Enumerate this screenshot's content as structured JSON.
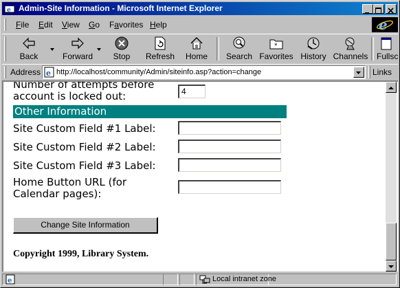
{
  "window": {
    "title": "Admin-Site Information - Microsoft Internet Explorer"
  },
  "menu": [
    {
      "label": "File",
      "key": "F"
    },
    {
      "label": "Edit",
      "key": "E"
    },
    {
      "label": "View",
      "key": "V"
    },
    {
      "label": "Go",
      "key": "G"
    },
    {
      "label": "Favorites",
      "key": "a"
    },
    {
      "label": "Help",
      "key": "H"
    }
  ],
  "toolbar": {
    "back": "Back",
    "forward": "Forward",
    "stop": "Stop",
    "refresh": "Refresh",
    "home": "Home",
    "search": "Search",
    "favorites": "Favorites",
    "history": "History",
    "channels": "Channels",
    "fullscreen": "Fullsc"
  },
  "address": {
    "label": "Address",
    "url": "http://localhost/community/Admin/siteinfo.asp?action=change",
    "links": "Links"
  },
  "form": {
    "lockout_label_line1": "Number of attempts before",
    "lockout_label_line2": "account is locked out:",
    "lockout_value": "4",
    "section_title": "Other Information",
    "custom1_label": "Site Custom Field #1 Label:",
    "custom2_label": "Site Custom Field #2 Label:",
    "custom3_label": "Site Custom Field #3 Label:",
    "home_url_label_line1": "Home Button URL (for",
    "home_url_label_line2": "Calendar pages):",
    "custom1_value": "",
    "custom2_value": "",
    "custom3_value": "",
    "home_url_value": "",
    "submit_label": "Change Site Information",
    "copyright": "Copyright 1999, Library System."
  },
  "status": {
    "zone": "Local intranet zone"
  },
  "colors": {
    "section_header": "#008080",
    "titlebar": "#000080"
  }
}
